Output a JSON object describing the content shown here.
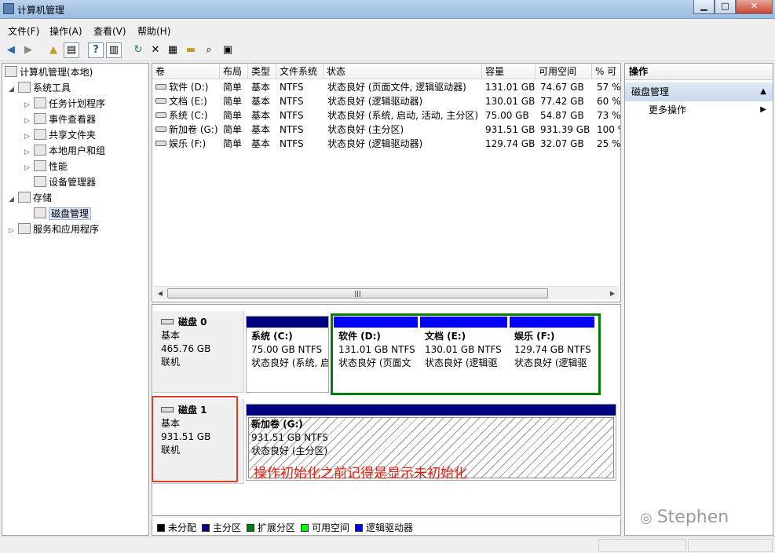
{
  "window": {
    "title": "计算机管理",
    "btn_min": "▁",
    "btn_max": "□",
    "btn_close": "✕"
  },
  "menu": [
    "文件(F)",
    "操作(A)",
    "查看(V)",
    "帮助(H)"
  ],
  "tree": {
    "root": "计算机管理(本地)",
    "system_tools": "系统工具",
    "task_scheduler": "任务计划程序",
    "event_viewer": "事件查看器",
    "shared_folders": "共享文件夹",
    "local_users": "本地用户和组",
    "performance": "性能",
    "device_manager": "设备管理器",
    "storage": "存储",
    "disk_management": "磁盘管理",
    "services_apps": "服务和应用程序"
  },
  "volumes": {
    "headers": [
      "卷",
      "布局",
      "类型",
      "文件系统",
      "状态",
      "容量",
      "可用空间",
      "% 可"
    ],
    "rows": [
      [
        "软件 (D:)",
        "简单",
        "基本",
        "NTFS",
        "状态良好 (页面文件, 逻辑驱动器)",
        "131.01 GB",
        "74.67 GB",
        "57 %"
      ],
      [
        "文档 (E:)",
        "简单",
        "基本",
        "NTFS",
        "状态良好 (逻辑驱动器)",
        "130.01 GB",
        "77.42 GB",
        "60 %"
      ],
      [
        "系统 (C:)",
        "简单",
        "基本",
        "NTFS",
        "状态良好 (系统, 启动, 活动, 主分区)",
        "75.00 GB",
        "54.87 GB",
        "73 %"
      ],
      [
        "新加卷 (G:)",
        "简单",
        "基本",
        "NTFS",
        "状态良好 (主分区)",
        "931.51 GB",
        "931.39 GB",
        "100 %"
      ],
      [
        "娱乐 (F:)",
        "简单",
        "基本",
        "NTFS",
        "状态良好 (逻辑驱动器)",
        "129.74 GB",
        "32.07 GB",
        "25 %"
      ]
    ]
  },
  "disk0": {
    "name": "磁盘 0",
    "type": "基本",
    "size": "465.76 GB",
    "status": "联机",
    "partitions": [
      {
        "name": "系统  (C:)",
        "size": "75.00 GB NTFS",
        "status": "状态良好 (系统, 启"
      },
      {
        "name": "软件  (D:)",
        "size": "131.01 GB NTFS",
        "status": "状态良好 (页面文"
      },
      {
        "name": "文档  (E:)",
        "size": "130.01 GB NTFS",
        "status": "状态良好 (逻辑驱"
      },
      {
        "name": "娱乐  (F:)",
        "size": "129.74 GB NTFS",
        "status": "状态良好 (逻辑驱"
      }
    ]
  },
  "disk1": {
    "name": "磁盘 1",
    "type": "基本",
    "size": "931.51 GB",
    "status": "联机",
    "partition": {
      "name": "新加卷  (G:)",
      "size": "931.51 GB NTFS",
      "status": "状态良好 (主分区)"
    }
  },
  "annotation": "操作初始化之前记得是显示未初始化",
  "legend": [
    {
      "label": "未分配",
      "color": "#000000"
    },
    {
      "label": "主分区",
      "color": "#000080"
    },
    {
      "label": "扩展分区",
      "color": "#008000"
    },
    {
      "label": "可用空间",
      "color": "#00ff00"
    },
    {
      "label": "逻辑驱动器",
      "color": "#0000ff"
    }
  ],
  "actions": {
    "header": "操作",
    "section": "磁盘管理",
    "more": "更多操作"
  },
  "watermark": "Stephen",
  "colors": {
    "primary": "#000080",
    "logical": "#0000ff",
    "extended": "#008000",
    "annotation": "#e8200f"
  }
}
